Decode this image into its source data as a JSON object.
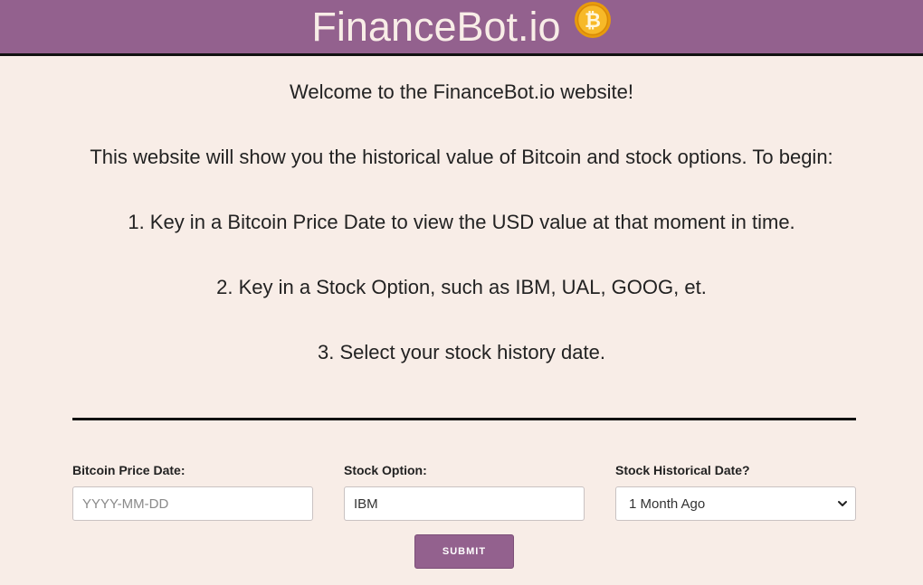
{
  "header": {
    "title": "FinanceBot.io",
    "coin_icon": "bitcoin-icon",
    "coin_symbol": "₿",
    "colors": {
      "bar": "#93618e",
      "title": "#f8ede7",
      "coin": "#f2a900"
    }
  },
  "intro": {
    "welcome": "Welcome to the FinanceBot.io website!",
    "description": "This website will show you the historical value of Bitcoin and stock options. To begin:",
    "step1": "1. Key in a Bitcoin Price Date to view the USD value at that moment in time.",
    "step2": "2. Key in a Stock Option, such as IBM, UAL, GOOG, et.",
    "step3": "3. Select your stock history date."
  },
  "form": {
    "bitcoin_date": {
      "label": "Bitcoin Price Date:",
      "value": "",
      "placeholder": "YYYY-MM-DD"
    },
    "stock_option": {
      "label": "Stock Option:",
      "value": "IBM",
      "placeholder": ""
    },
    "history_date": {
      "label": "Stock Historical Date?",
      "selected": "1 Month Ago"
    },
    "submit_label": "SUBMIT"
  },
  "colors": {
    "background": "#f8ede7",
    "accent": "#93618e"
  }
}
